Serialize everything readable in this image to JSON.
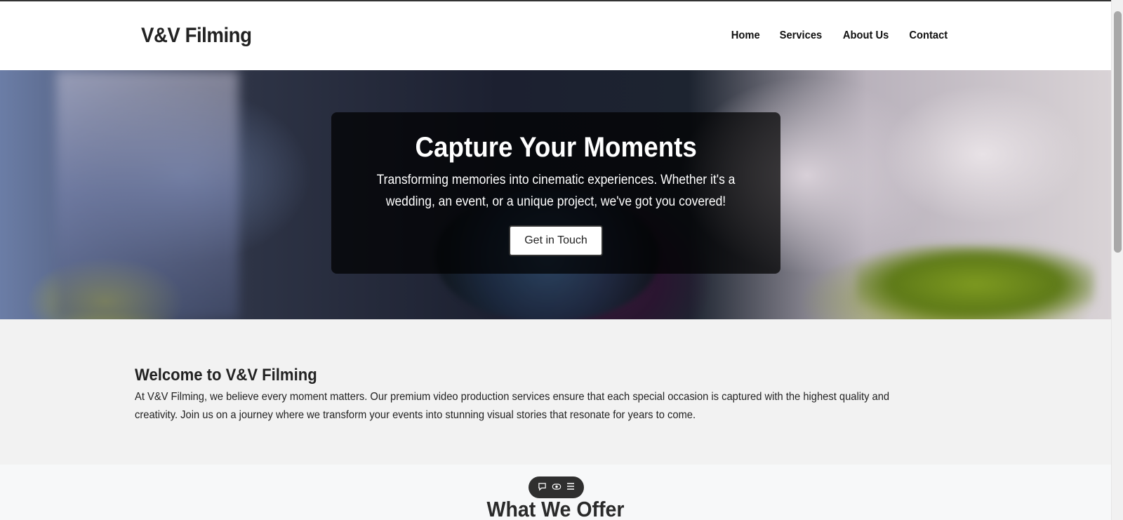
{
  "header": {
    "logo": "V&V Filming",
    "nav": [
      "Home",
      "Services",
      "About Us",
      "Contact"
    ]
  },
  "hero": {
    "title": "Capture Your Moments",
    "subtitle": "Transforming memories into cinematic experiences. Whether it's a wedding, an event, or a unique project, we've got you covered!",
    "button": "Get in Touch"
  },
  "welcome": {
    "heading": "Welcome to V&V Filming",
    "text": "At V&V Filming, we believe every moment matters. Our premium video production services ensure that each special occasion is captured with the highest quality and creativity. Join us on a journey where we transform your events into stunning visual stories that resonate for years to come."
  },
  "offer": {
    "heading": "What We Offer"
  },
  "float_toolbar": {
    "icons": [
      "comment-icon",
      "eye-icon",
      "menu-icon"
    ]
  },
  "colors": {
    "header_bg": "#ffffff",
    "welcome_bg": "#f2f2f2",
    "card_bg": "rgba(0,0,0,0.72)"
  }
}
